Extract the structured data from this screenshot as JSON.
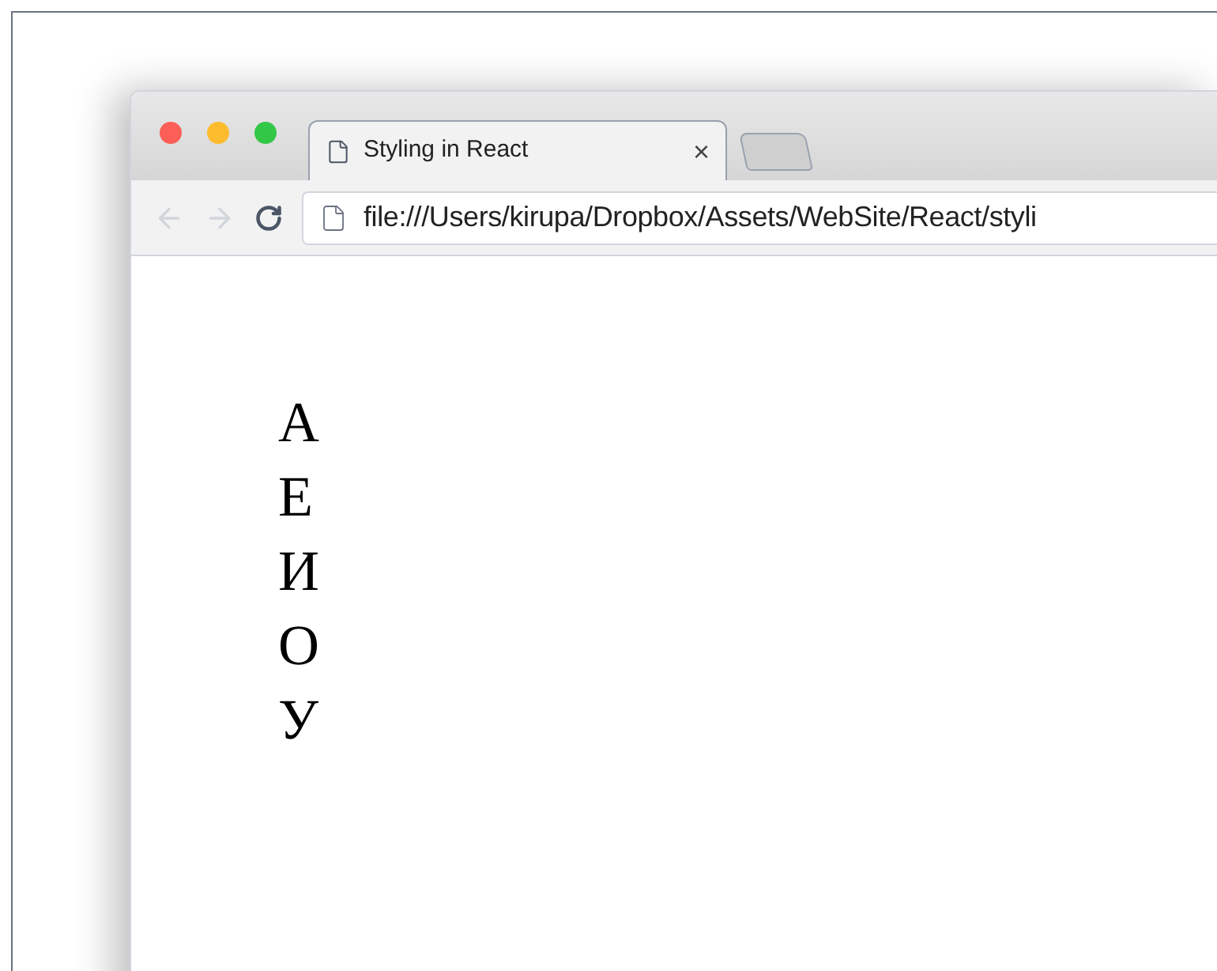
{
  "browser": {
    "tabs": [
      {
        "title": "Styling in React",
        "close": "×",
        "selected": true
      },
      {
        "selected": false
      }
    ],
    "address": "file:///Users/kirupa/Dropbox/Assets/WebSite/React/styli"
  },
  "page": {
    "letters": [
      "А",
      "Е",
      "И",
      "О",
      "У"
    ]
  }
}
